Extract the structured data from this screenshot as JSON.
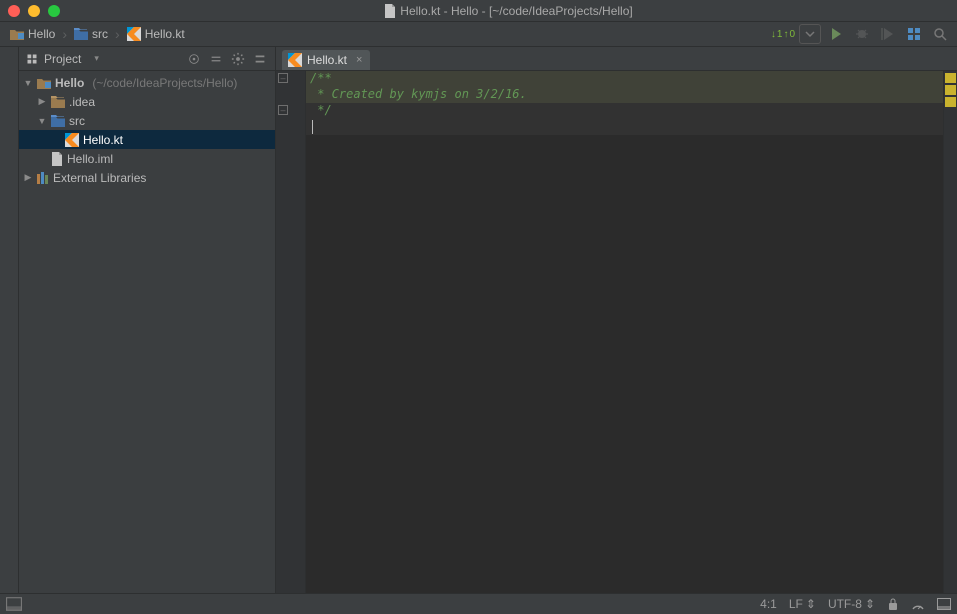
{
  "window": {
    "title": "Hello.kt - Hello - [~/code/IdeaProjects/Hello]"
  },
  "breadcrumb": {
    "items": [
      {
        "label": "Hello",
        "icon": "module"
      },
      {
        "label": "src",
        "icon": "folder"
      },
      {
        "label": "Hello.kt",
        "icon": "kotlin-file"
      }
    ]
  },
  "runbar": {
    "sync_up": "0",
    "sync_down": "1"
  },
  "tool_window": {
    "title": "Project"
  },
  "tree": {
    "root": {
      "label": "Hello",
      "hint": "(~/code/IdeaProjects/Hello)"
    },
    "idea_folder": ".idea",
    "src_folder": "src",
    "hello_kt": "Hello.kt",
    "hello_iml": "Hello.iml",
    "external_libraries": "External Libraries"
  },
  "tabs": [
    {
      "label": "Hello.kt",
      "icon": "kotlin-file",
      "active": true
    }
  ],
  "editor": {
    "lines": [
      "/**",
      " * Created by kymjs on 3/2/16.",
      " */",
      ""
    ]
  },
  "status": {
    "position": "4:1",
    "line_sep": "LF",
    "encoding": "UTF-8"
  }
}
